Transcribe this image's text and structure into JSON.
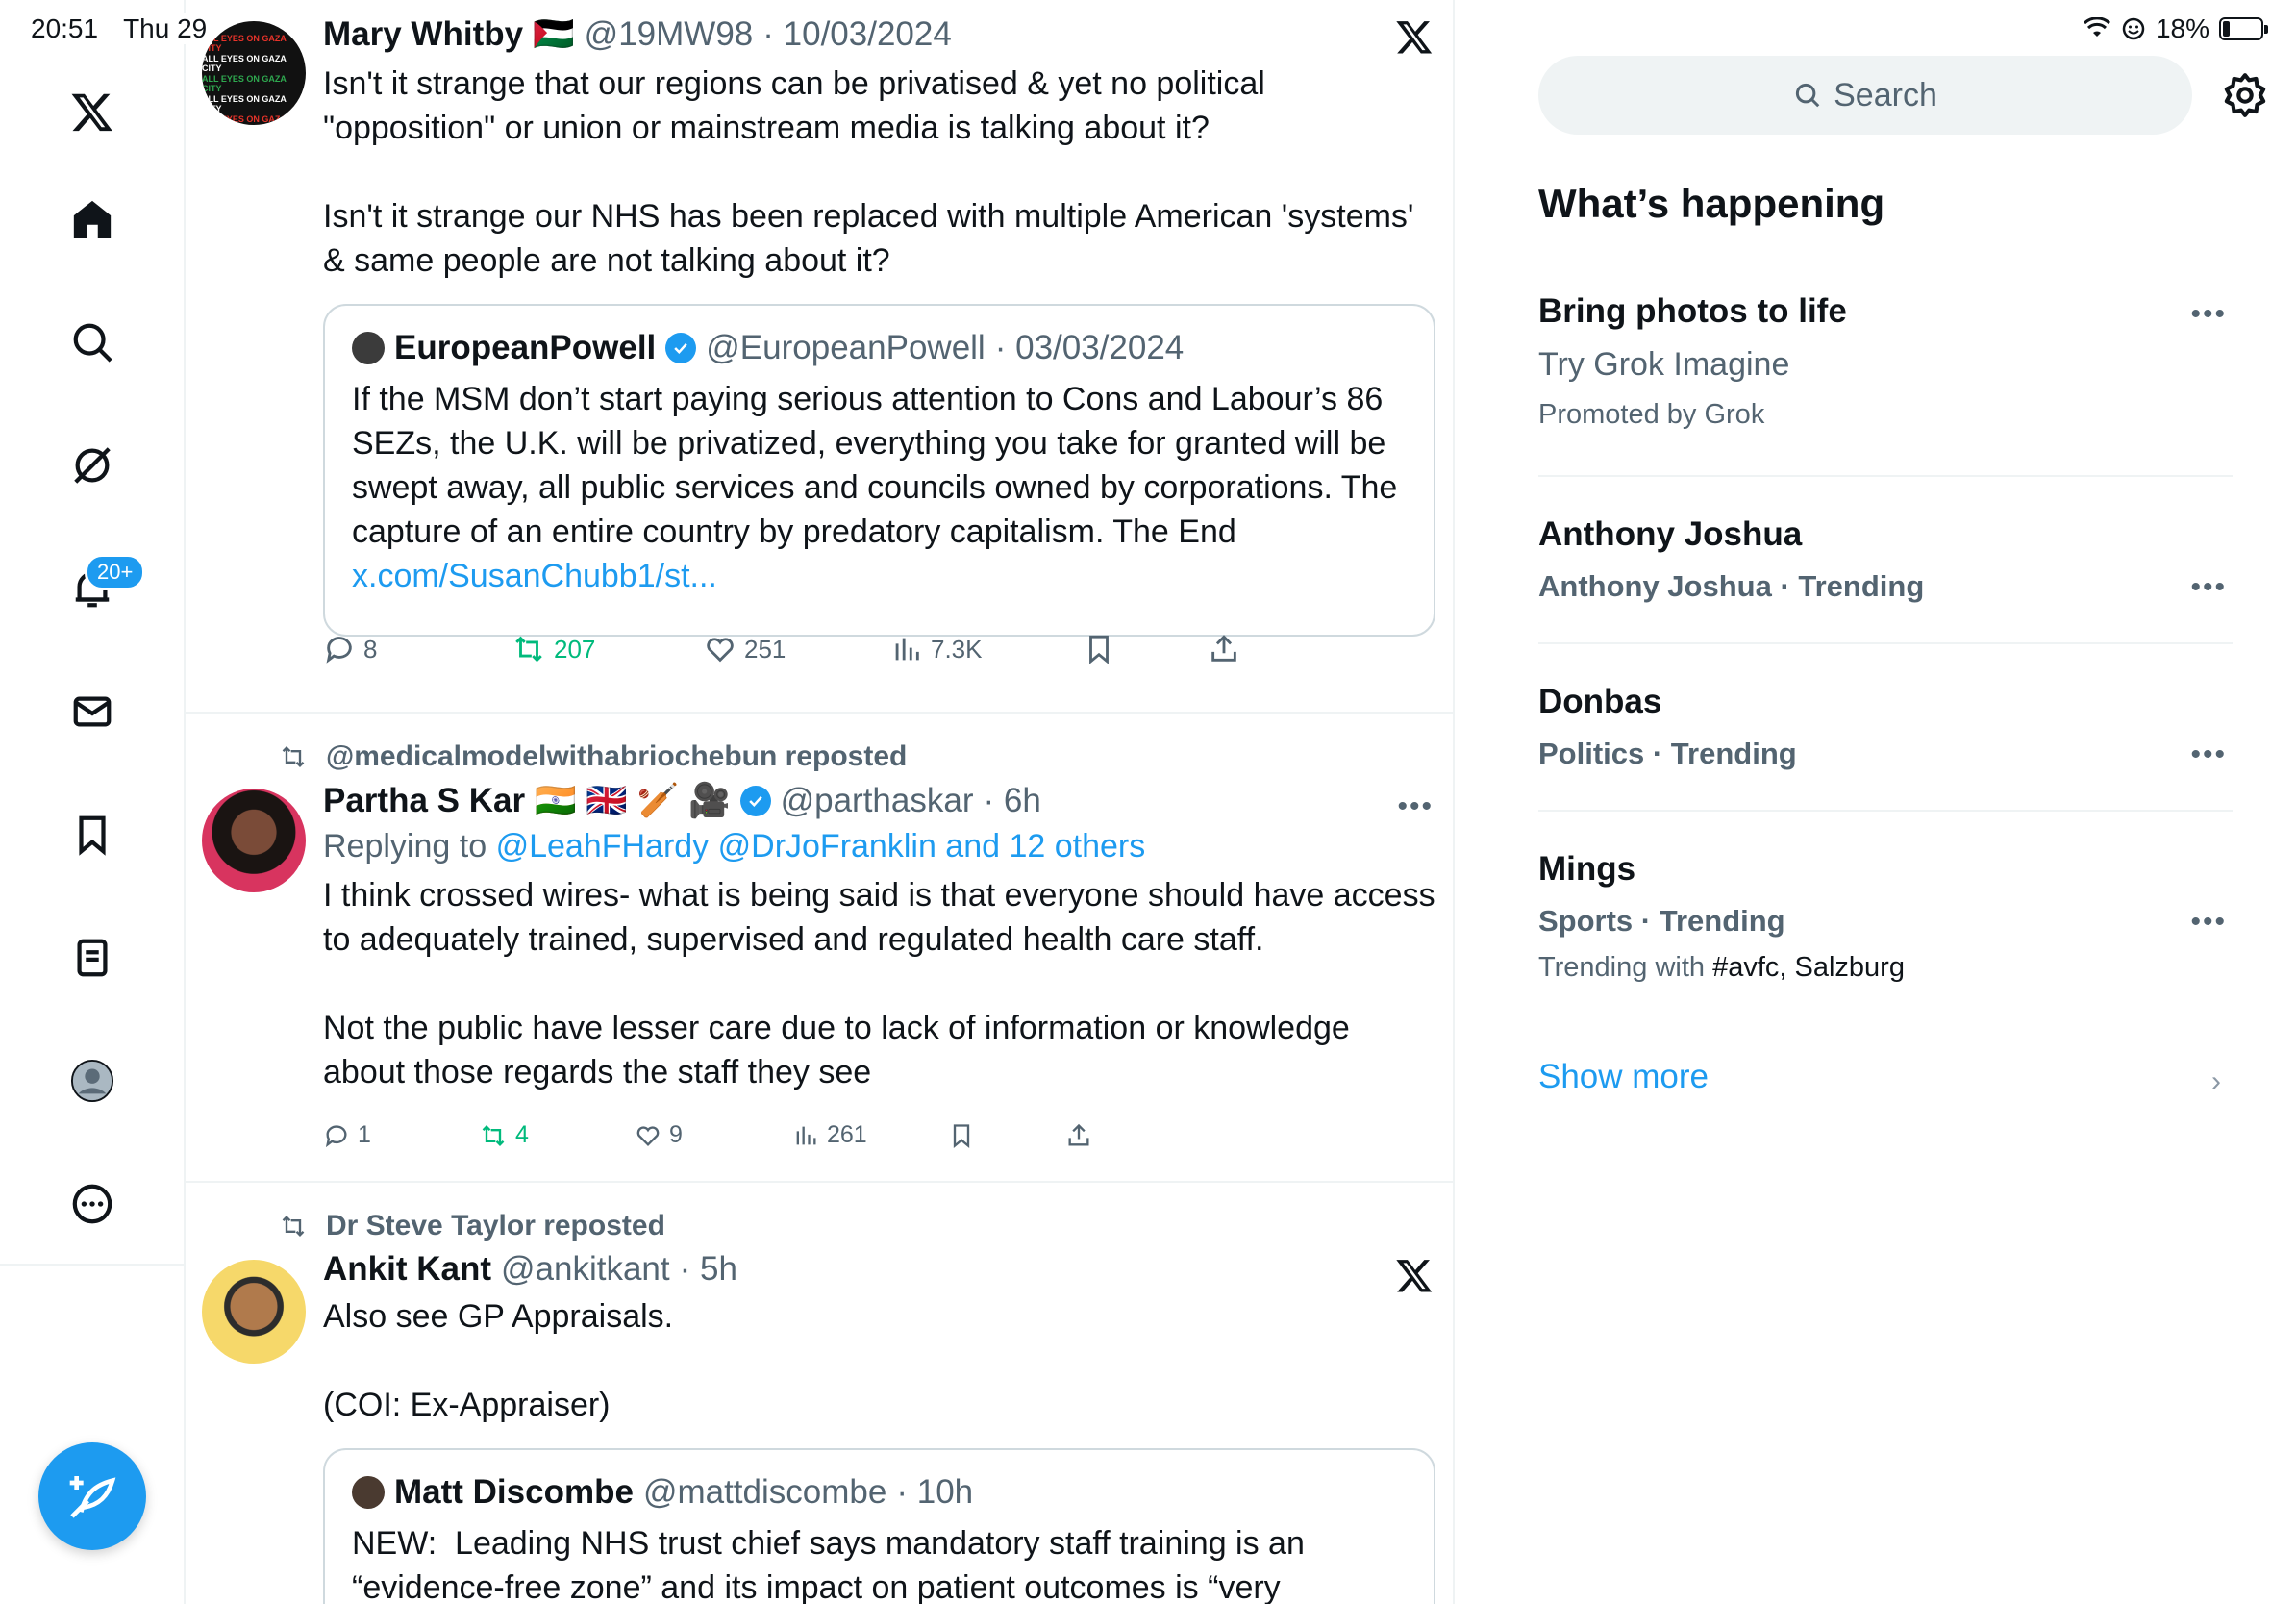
{
  "status_bar": {
    "time": "20:51",
    "date": "Thu 29",
    "battery": "18%",
    "battery_level": 0.18
  },
  "nav": {
    "notifications_badge": "20+"
  },
  "posts": [
    {
      "name": "Mary Whitby",
      "flag": "🇵🇸",
      "handle": "@19MW98",
      "date": "· 10/03/2024",
      "text": "Isn't it strange that our regions can be privatised & yet no political \"opposition\" or union or mainstream media is talking about it?\n\nIsn't it strange our NHS has been replaced with multiple American 'systems' & same people are not talking about it?",
      "avatar_text": "ALL EYES ON GAZA CITY",
      "quote": {
        "name": "EuropeanPowell",
        "handle": "@EuropeanPowell",
        "date": "· 03/03/2024",
        "text": "If the MSM don’t start paying serious attention to Cons and Labour’s 86 SEZs, the U.K. will be privatized, everything you take for granted will be swept away, all public services and councils owned by corporations. The capture of an entire country by predatory capitalism. The End",
        "link": "x.com/SusanChubb1/st..."
      },
      "stats": {
        "replies": "8",
        "reposts": "207",
        "likes": "251",
        "views": "7.3K"
      }
    },
    {
      "reposted_by": "@medicalmodelwithabriochebun reposted",
      "name": "Partha S Kar",
      "flags": "🇮🇳 🇬🇧 🏏 🎥",
      "handle": "@parthaskar",
      "date": "· 6h",
      "replying_prefix": "Replying to",
      "replying_to": "@LeahFHardy @DrJoFranklin and 12 others",
      "text": "I think crossed wires- what is being said is that everyone should have access to adequately trained, supervised and regulated health care staff.\n\nNot the public have lesser care due to lack of information or knowledge about those regards the staff they see",
      "stats": {
        "replies": "1",
        "reposts": "4",
        "likes": "9",
        "views": "261"
      }
    },
    {
      "reposted_by": "Dr Steve Taylor reposted",
      "name": "Ankit Kant",
      "handle": "@ankitkant",
      "date": "· 5h",
      "text": "Also see GP Appraisals.\n\n(COI: Ex-Appraiser)",
      "quote": {
        "name": "Matt Discombe",
        "handle": "@mattdiscombe",
        "date": "· 10h",
        "text": "NEW:  Leading NHS trust chief says mandatory staff training is an “evidence-free zone” and its impact on patient outcomes is “very"
      }
    }
  ],
  "sidebar": {
    "search_placeholder": "Search",
    "heading": "What’s happening",
    "trends": [
      {
        "title": "Bring photos to life",
        "line1": "Try Grok Imagine",
        "line2": "Promoted by Grok"
      },
      {
        "title": "Anthony Joshua",
        "line1": "Anthony Joshua · Trending"
      },
      {
        "title": "Donbas",
        "line1": "Politics · Trending"
      },
      {
        "title": "Mings",
        "line1": "Sports · Trending",
        "line2_prefix": "Trending with ",
        "line2_tags": "#avfc, Salzburg"
      }
    ],
    "show_more": "Show more"
  },
  "colors": {
    "accent": "#1d9bf0",
    "repost_green": "#00ba7c",
    "muted": "#536471",
    "border": "#eff3f4"
  }
}
